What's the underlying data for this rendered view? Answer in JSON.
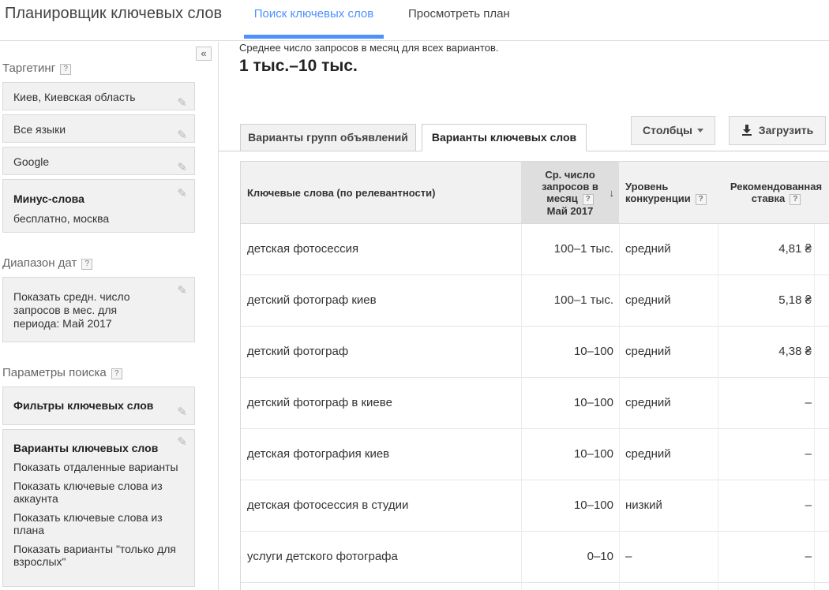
{
  "header": {
    "app_title": "Планировщик ключевых слов",
    "tab_search": "Поиск ключевых слов",
    "tab_plan": "Просмотреть план"
  },
  "sidebar": {
    "collapse_icon": "«",
    "targeting_title": "Таргетинг",
    "targeting_items": [
      "Киев, Киевская область",
      "Все языки",
      "Google"
    ],
    "negative_title": "Минус-слова",
    "negative_value": "бесплатно, москва",
    "daterange_title": "Диапазон дат",
    "daterange_lines": [
      "Показать средн. число",
      "запросов в мес. для",
      "периода: Май 2017"
    ],
    "search_params_title": "Параметры поиска",
    "filters_label": "Фильтры ключевых слов",
    "options_title": "Варианты ключевых слов",
    "options_lines": [
      "Показать отдаленные варианты",
      "Показать ключевые слова из",
      "аккаунта",
      "Показать ключевые слова из",
      "плана",
      "Показать варианты \"только для",
      "взрослых\""
    ],
    "help_glyph": "?",
    "edit_icon": "pencil-icon"
  },
  "summary": {
    "label": "Среднее число запросов в месяц для всех вариантов.",
    "value": "1 тыс.–10 тыс."
  },
  "subtabs": {
    "ad_groups": "Варианты групп объявлений",
    "keywords": "Варианты ключевых слов"
  },
  "toolbar": {
    "columns": "Столбцы",
    "download": "Загрузить"
  },
  "table": {
    "col_keyword": "Ключевые слова (по релевантности)",
    "col_avg_lines": [
      "Ср. число",
      "запросов в",
      "месяц",
      "Май 2017"
    ],
    "col_comp_lines": [
      "Уровень",
      "конкуренции"
    ],
    "col_bid_lines": [
      "Рекомендованная",
      "ставка"
    ],
    "rows": [
      {
        "keyword": "детская фотосессия",
        "avg": "100–1 тыс.",
        "competition": "средний",
        "bid": "4,81 ₴"
      },
      {
        "keyword": "детский фотограф киев",
        "avg": "100–1 тыс.",
        "competition": "средний",
        "bid": "5,18 ₴"
      },
      {
        "keyword": "детский фотограф",
        "avg": "10–100",
        "competition": "средний",
        "bid": "4,38 ₴"
      },
      {
        "keyword": "детский фотограф в киеве",
        "avg": "10–100",
        "competition": "средний",
        "bid": "–"
      },
      {
        "keyword": "детская фотография киев",
        "avg": "10–100",
        "competition": "средний",
        "bid": "–"
      },
      {
        "keyword": "детская фотосессия в студии",
        "avg": "10–100",
        "competition": "низкий",
        "bid": "–"
      },
      {
        "keyword": "услуги детского фотографа",
        "avg": "0–10",
        "competition": "–",
        "bid": "–"
      }
    ]
  }
}
